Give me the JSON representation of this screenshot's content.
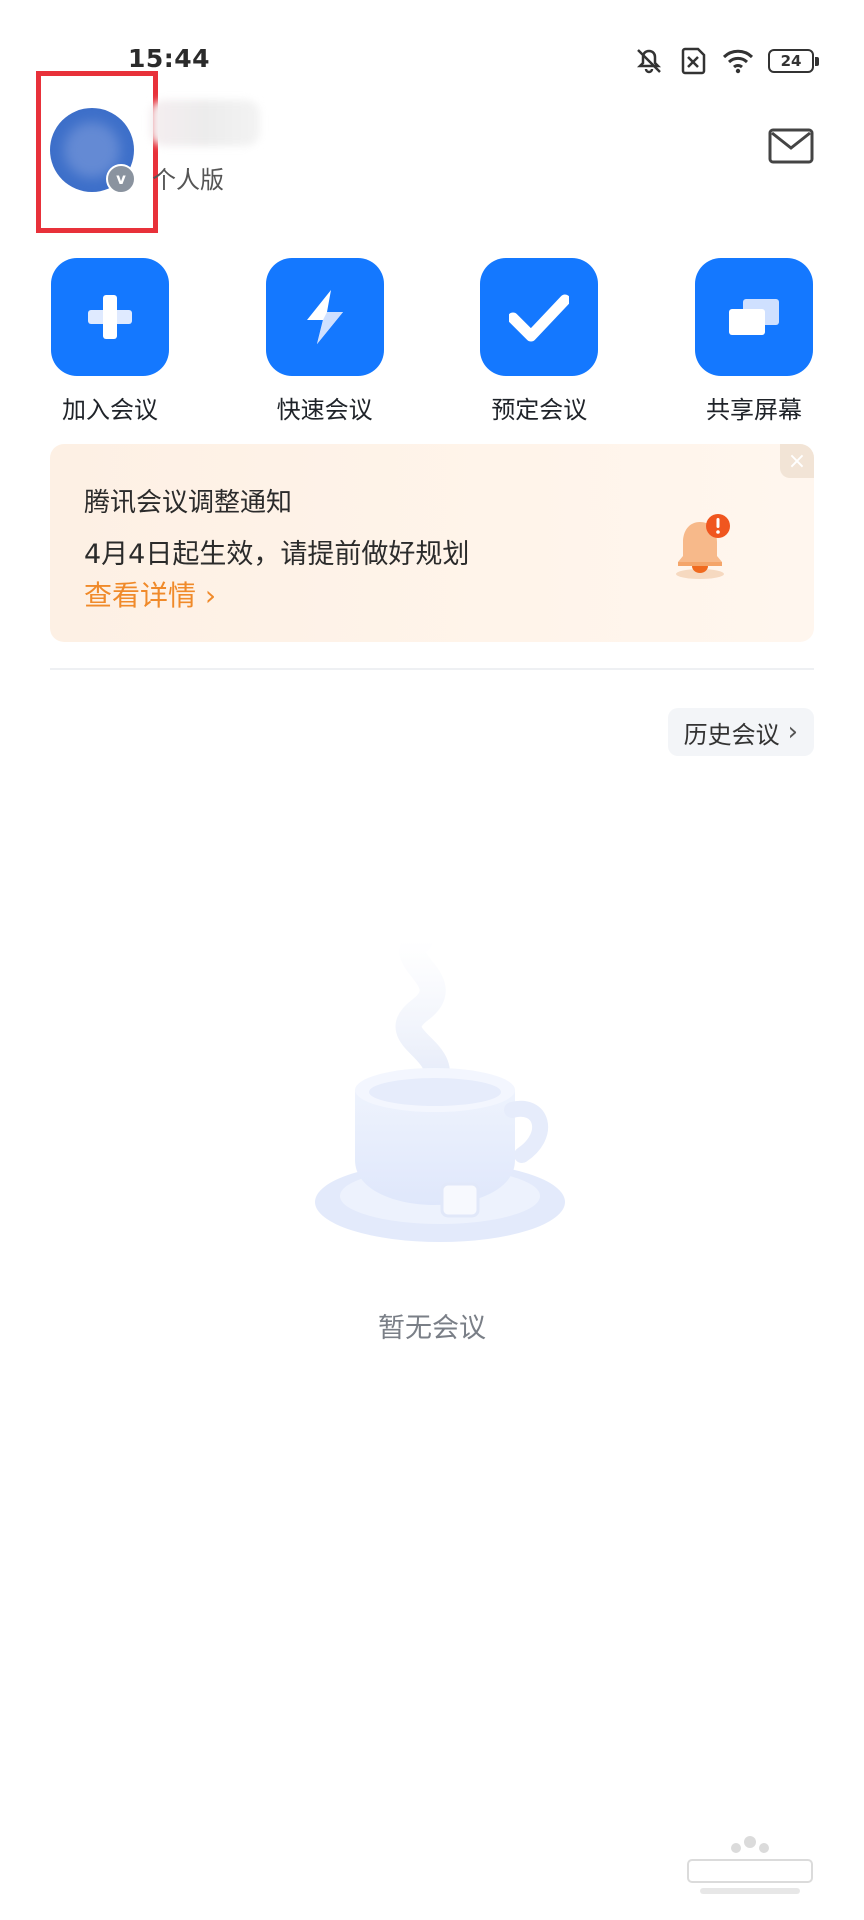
{
  "status_bar": {
    "time": "15:44",
    "battery": "24",
    "icons": [
      "mute-vibrate-icon",
      "sim-off-icon",
      "wifi-icon",
      "battery-icon"
    ]
  },
  "header": {
    "edition": "个人版",
    "icons": [
      "avatar",
      "verified-badge-icon",
      "mail-icon"
    ],
    "badge": "v"
  },
  "actions": [
    {
      "label": "加入会议",
      "icon": "plus-icon"
    },
    {
      "label": "快速会议",
      "icon": "lightning-icon"
    },
    {
      "label": "预定会议",
      "icon": "check-icon"
    },
    {
      "label": "共享屏幕",
      "icon": "screen-share-icon"
    }
  ],
  "notice": {
    "title": "腾讯会议调整通知",
    "body": "4月4日起生效，请提前做好规划",
    "link": "查看详情",
    "close": "×",
    "icon": "bell-icon"
  },
  "history": {
    "label": "历史会议"
  },
  "empty_state": {
    "text": "暂无会议",
    "icon": "coffee-cup-icon"
  },
  "colors": {
    "primary": "#1478ff",
    "notice_link": "#f08a2a",
    "highlight": "#e8313a",
    "avatar": "#3d6fc9"
  }
}
